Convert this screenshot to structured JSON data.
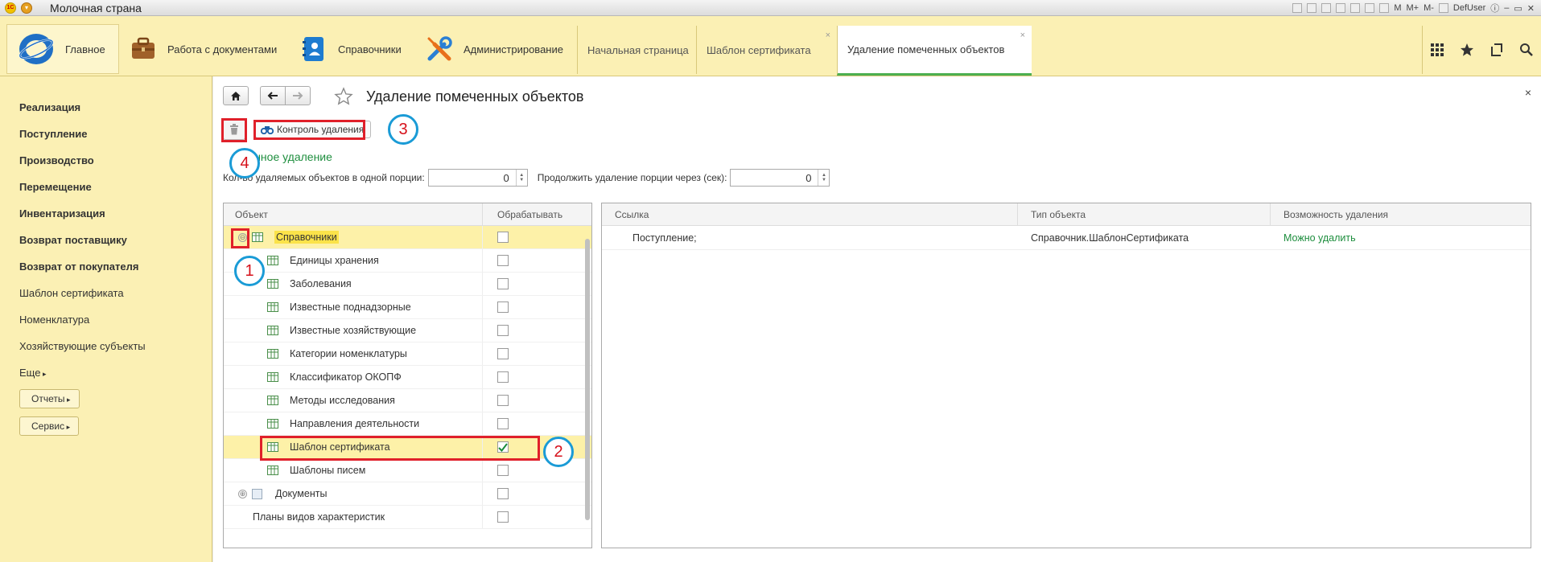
{
  "window": {
    "title": "Молочная страна",
    "user": "DefUser",
    "memory_buttons": [
      "M",
      "M+",
      "M-"
    ]
  },
  "sections": {
    "main_label": "Главное",
    "items": [
      {
        "label": "Работа с документами",
        "icon": "briefcase-icon"
      },
      {
        "label": "Справочники",
        "icon": "address-book-icon"
      },
      {
        "label": "Администрирование",
        "icon": "tools-icon"
      }
    ],
    "tabs": [
      {
        "label": "Начальная страница",
        "closable": false,
        "active": false
      },
      {
        "label": "Шаблон сертификата",
        "closable": true,
        "active": false
      },
      {
        "label": "Удаление помеченных объектов",
        "closable": true,
        "active": true
      }
    ],
    "close_glyph": "×"
  },
  "leftnav": {
    "items": [
      {
        "label": "Реализация",
        "bold": true
      },
      {
        "label": "Поступление",
        "bold": true
      },
      {
        "label": "Производство",
        "bold": true
      },
      {
        "label": "Перемещение",
        "bold": true
      },
      {
        "label": "Инвентаризация",
        "bold": true
      },
      {
        "label": "Возврат поставщику",
        "bold": true
      },
      {
        "label": "Возврат от покупателя",
        "bold": true
      },
      {
        "label": "Шаблон сертификата",
        "bold": false
      },
      {
        "label": "Номенклатура",
        "bold": false
      },
      {
        "label": "Хозяйствующие субъекты",
        "bold": false
      }
    ],
    "more_label": "Еще",
    "reports_label": "Отчеты",
    "service_label": "Сервис"
  },
  "form": {
    "title": "Удаление помеченных объектов",
    "close_glyph": "×",
    "control_button_label": "Контроль удаления",
    "mode_link": "Выборочное удаление",
    "mode_link_visible": "онное удаление",
    "mode_link_prefix": "Вы",
    "portion_label_prefix": "Кол-",
    "portion_label_visible": "во удаляемых объектов в одной порции:",
    "portion_value": "0",
    "delay_label": "Продолжить удаление порции через (сек):",
    "delay_value": "0"
  },
  "annotations": {
    "n1": "1",
    "n2": "2",
    "n3": "3",
    "n4": "4"
  },
  "tree": {
    "headers": {
      "object": "Объект",
      "process": "Обрабатывать"
    },
    "rows": [
      {
        "label": "Справочники",
        "level": 0,
        "expander": "⊖",
        "highlighted": true,
        "selected": true,
        "checked": false
      },
      {
        "label": "Единицы хранения",
        "level": 1,
        "checked": false
      },
      {
        "label": "Заболевания",
        "level": 1,
        "checked": false
      },
      {
        "label": "Известные поднадзорные",
        "level": 1,
        "checked": false
      },
      {
        "label": "Известные хозяйствующие",
        "level": 1,
        "checked": false
      },
      {
        "label": "Категории номенклатуры",
        "level": 1,
        "checked": false
      },
      {
        "label": "Классификатор ОКОПФ",
        "level": 1,
        "checked": false
      },
      {
        "label": "Методы исследования",
        "level": 1,
        "checked": false
      },
      {
        "label": "Направления деятельности",
        "level": 1,
        "checked": false
      },
      {
        "label": "Шаблон сертификата",
        "level": 1,
        "checked": true,
        "selected": true
      },
      {
        "label": "Шаблоны писем",
        "level": 1,
        "checked": false
      },
      {
        "label": "Документы",
        "level": 0,
        "expander": "⊕",
        "doc": true,
        "checked": false
      },
      {
        "label": "Планы видов характеристик",
        "level": 0,
        "plain": true,
        "checked": false
      }
    ]
  },
  "result": {
    "headers": {
      "link": "Ссылка",
      "type": "Тип объекта",
      "possibility": "Возможность удаления"
    },
    "rows": [
      {
        "link": "Поступление;",
        "type": "Справочник.ШаблонСертификата",
        "possibility": "Можно удалить"
      }
    ]
  }
}
